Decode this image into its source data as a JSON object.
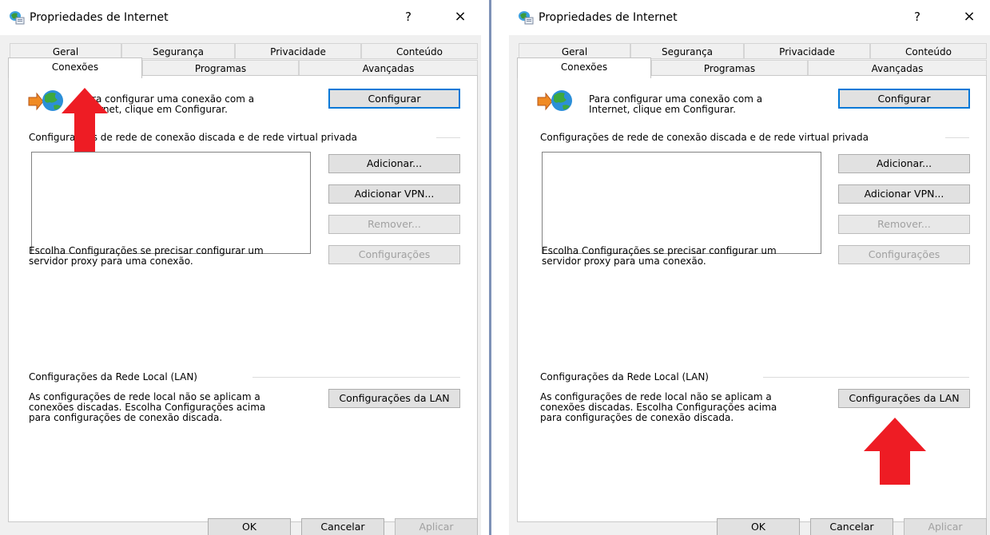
{
  "dialogs": [
    {
      "title": "Propriedades de Internet",
      "help_glyph": "?",
      "close_glyph": "×",
      "tabs_back": [
        "Geral",
        "Segurança",
        "Privacidade",
        "Conteúdo"
      ],
      "tabs_front": [
        "Conexões",
        "Programas",
        "Avançadas"
      ],
      "active_tab": "Conexões",
      "setup_text_line1": "Para configurar uma conexão com a",
      "setup_text_line2": "Internet, clique em Configurar.",
      "setup_button": "Configurar",
      "dialup_section_label": "Configurações de rede de conexão discada e de rede virtual privada",
      "add_button": "Adicionar...",
      "add_vpn_button": "Adicionar VPN...",
      "remove_button": "Remover...",
      "settings_button": "Configurações",
      "proxy_text_line1": "Escolha Configurações se precisar configurar um",
      "proxy_text_line2": "servidor proxy para uma conexão.",
      "lan_section_label": "Configurações da Rede Local (LAN)",
      "lan_text_line1": "As configurações de rede local não se aplicam a",
      "lan_text_line2": "conexões discadas. Escolha Configurações acima",
      "lan_text_line3": "para configurações de conexão discada.",
      "lan_settings_button": "Configurações da LAN",
      "ok_button": "OK",
      "cancel_button": "Cancelar",
      "apply_button": "Aplicar",
      "arrow_target": "tab-conexoes"
    },
    {
      "title": "Propriedades de Internet",
      "help_glyph": "?",
      "close_glyph": "×",
      "tabs_back": [
        "Geral",
        "Segurança",
        "Privacidade",
        "Conteúdo"
      ],
      "tabs_front": [
        "Conexões",
        "Programas",
        "Avançadas"
      ],
      "active_tab": "Conexões",
      "setup_text_line1": "Para configurar uma conexão com a",
      "setup_text_line2": "Internet, clique em Configurar.",
      "setup_button": "Configurar",
      "dialup_section_label": "Configurações de rede de conexão discada e de rede virtual privada",
      "add_button": "Adicionar...",
      "add_vpn_button": "Adicionar VPN...",
      "remove_button": "Remover...",
      "settings_button": "Configurações",
      "proxy_text_line1": "Escolha Configurações se precisar configurar um",
      "proxy_text_line2": "servidor proxy para uma conexão.",
      "lan_section_label": "Configurações da Rede Local (LAN)",
      "lan_text_line1": "As configurações de rede local não se aplicam a",
      "lan_text_line2": "conexões discadas. Escolha Configurações acima",
      "lan_text_line3": "para configurações de conexão discada.",
      "lan_settings_button": "Configurações da LAN",
      "ok_button": "OK",
      "cancel_button": "Cancelar",
      "apply_button": "Aplicar",
      "arrow_target": "lan-settings-button"
    }
  ],
  "colors": {
    "arrow_red": "#ee1c24",
    "default_button_border": "#0078d7",
    "divider": "#7e92b7"
  },
  "icons": {
    "title_icon": "internet-options-icon",
    "connection_icon": "globe-connection-icon"
  }
}
